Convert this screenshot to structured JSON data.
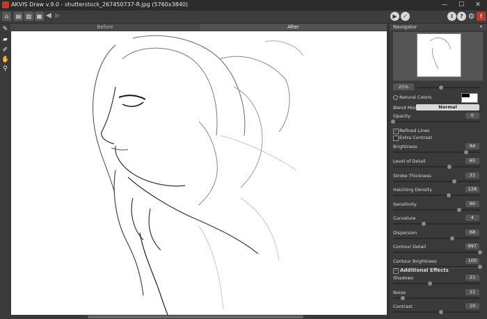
{
  "window": {
    "title": "AKVIS Draw v.9.0 - shutterstock_267450737-R.jpg (5760x3840)",
    "minimize": "—",
    "maximize": "☐",
    "close": "✕"
  },
  "tabs": {
    "before": "Before",
    "after": "After"
  },
  "navigator": {
    "title": "Navigator",
    "zoom": "25%"
  },
  "settings": {
    "natural_colors": "Natural Colors",
    "blend_mode_label": "Blend Mode",
    "blend_mode_value": "Normal",
    "params": [
      {
        "label": "Opacity",
        "value": "0",
        "fraction": 0.0
      },
      {
        "label": "Brightness",
        "value": "84",
        "fraction": 0.84
      },
      {
        "label": "Level of Detail",
        "value": "65",
        "fraction": 0.65
      },
      {
        "label": "Stroke Thickness",
        "value": "21",
        "fraction": 0.7
      },
      {
        "label": "Hatching Density",
        "value": "128",
        "fraction": 0.64
      },
      {
        "label": "Sensitivity",
        "value": "60",
        "fraction": 0.76
      },
      {
        "label": "Curvature",
        "value": "4",
        "fraction": 0.35
      },
      {
        "label": "Dispersion",
        "value": "68",
        "fraction": 0.68
      },
      {
        "label": "Contour Detail",
        "value": "997",
        "fraction": 0.997
      },
      {
        "label": "Contour Brightness",
        "value": "100",
        "fraction": 1.0
      }
    ],
    "refined_lines": "Refined Lines",
    "extra_contrast": "Extra Contrast",
    "additional_effects": "Additional Effects",
    "effects": [
      {
        "label": "Shadows",
        "value": "21",
        "fraction": 0.42
      },
      {
        "label": "Noise",
        "value": "11",
        "fraction": 0.11
      },
      {
        "label": "Contrast",
        "value": "10",
        "fraction": 0.55
      }
    ]
  }
}
